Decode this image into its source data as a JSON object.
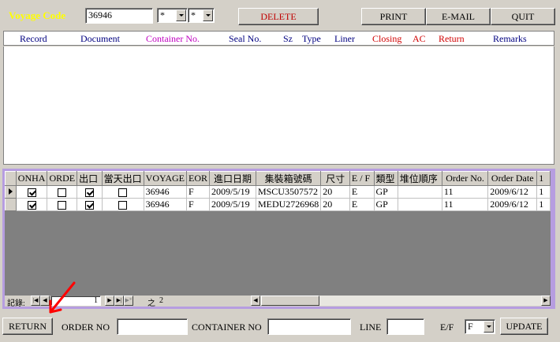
{
  "top": {
    "voyage_label": "Voyage Code",
    "voyage_value": "36946",
    "combo1_value": "*",
    "combo2_value": "*",
    "delete_label": "DELETE",
    "print_label": "PRINT",
    "email_label": "E-MAIL",
    "quit_label": "QUIT"
  },
  "header_cols": [
    "Record",
    "Document",
    "Container No.",
    "Seal No.",
    "Sz",
    "Type",
    "Liner",
    "Closing",
    "AC",
    "Return",
    "Remarks"
  ],
  "colors": {
    "voyage_label": "#ffff00",
    "header_blue": "#000080",
    "header_magenta": "#c000c0",
    "header_red": "#d00000",
    "grid_frame": "#b69de0",
    "arrow": "#ff0000"
  },
  "grid": {
    "columns": [
      "ONHA",
      "ORDE",
      "出口",
      "當天出口",
      "VOYAGE",
      "EOR",
      "進口日期",
      "集裝箱號碼",
      "尺寸",
      "E / F",
      "類型",
      "堆位順序",
      "Order No.",
      "Order Date",
      "1"
    ],
    "rows": [
      {
        "onha": true,
        "orde": false,
        "chukou": true,
        "dangtian": false,
        "voyage": "36946",
        "eor": "F",
        "date": "2009/5/19",
        "container": "MSCU3507572",
        "size": "20",
        "ef": "E",
        "type": "GP",
        "stack": "",
        "order_no": "11",
        "order_date": "2009/6/12",
        "extra": "1"
      },
      {
        "onha": true,
        "orde": false,
        "chukou": true,
        "dangtian": false,
        "voyage": "36946",
        "eor": "F",
        "date": "2009/5/19",
        "container": "MEDU2726968",
        "size": "20",
        "ef": "E",
        "type": "GP",
        "stack": "",
        "order_no": "11",
        "order_date": "2009/6/12",
        "extra": "1"
      }
    ]
  },
  "nav": {
    "record_label": "記錄:",
    "current": "1",
    "of_label": "之",
    "total": "2"
  },
  "bottom": {
    "return_label": "RETURN",
    "order_no_label": "ORDER NO",
    "order_no_value": "",
    "container_no_label": "CONTAINER NO",
    "container_no_value": "",
    "line_label": "LINE",
    "line_value": "",
    "ef_label": "E/F",
    "ef_value": "F",
    "update_label": "UPDATE"
  }
}
